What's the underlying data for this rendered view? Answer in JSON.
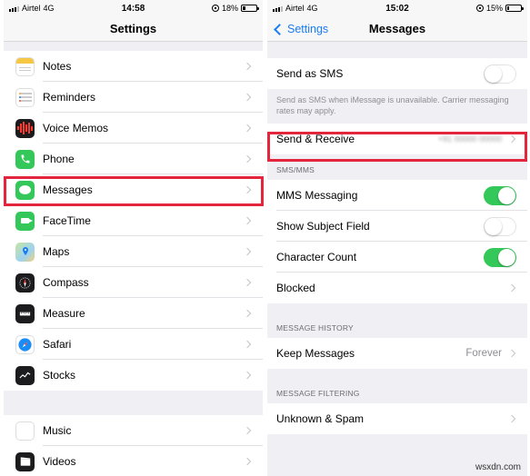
{
  "left_screen": {
    "status": {
      "carrier": "Airtel",
      "network": "4G",
      "time": "14:58",
      "battery": "18%",
      "battery_level": 0.18
    },
    "title": "Settings",
    "items": [
      {
        "label": "Notes"
      },
      {
        "label": "Reminders"
      },
      {
        "label": "Voice Memos"
      },
      {
        "label": "Phone"
      },
      {
        "label": "Messages"
      },
      {
        "label": "FaceTime"
      },
      {
        "label": "Maps"
      },
      {
        "label": "Compass"
      },
      {
        "label": "Measure"
      },
      {
        "label": "Safari"
      },
      {
        "label": "Stocks"
      }
    ],
    "items2": [
      {
        "label": "Music"
      },
      {
        "label": "Videos"
      }
    ]
  },
  "right_screen": {
    "status": {
      "carrier": "Airtel",
      "network": "4G",
      "time": "15:02",
      "battery": "15%",
      "battery_level": 0.15
    },
    "back_label": "Settings",
    "title": "Messages",
    "send_as_sms": {
      "label": "Send as SMS",
      "on": false
    },
    "sms_note": "Send as SMS when iMessage is unavailable. Carrier messaging rates may apply.",
    "send_receive": {
      "label": "Send & Receive",
      "value": "+91 00000 00000"
    },
    "sms_mms_header": "SMS/MMS",
    "mms_messaging": {
      "label": "MMS Messaging",
      "on": true
    },
    "show_subject": {
      "label": "Show Subject Field",
      "on": false
    },
    "character_count": {
      "label": "Character Count",
      "on": true
    },
    "blocked": {
      "label": "Blocked"
    },
    "history_header": "MESSAGE HISTORY",
    "keep_messages": {
      "label": "Keep Messages",
      "value": "Forever"
    },
    "filtering_header": "MESSAGE FILTERING",
    "unknown_spam": {
      "label": "Unknown & Spam"
    }
  },
  "colors": {
    "highlight": "#e3263e",
    "ios_green": "#34c759",
    "ios_blue": "#1a7cf5"
  },
  "watermark": "wsxdn.com"
}
